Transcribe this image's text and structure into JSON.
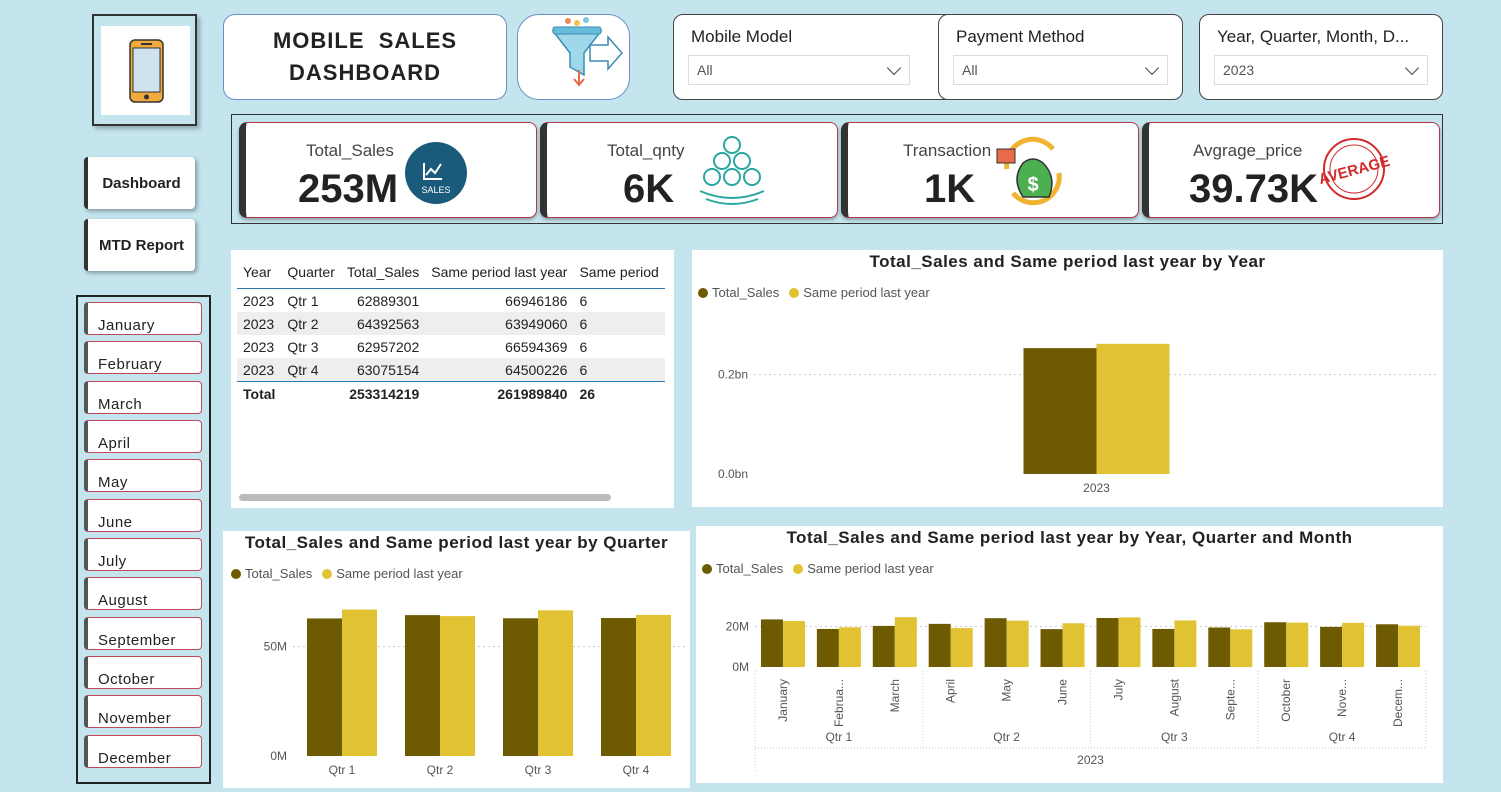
{
  "title": "MOBILE  SALES DASHBOARD",
  "title_line1": "MOBILE  SALES",
  "title_line2": "DASHBOARD",
  "nav": {
    "dashboard": "Dashboard",
    "mtd": "MTD Report"
  },
  "months": [
    "January",
    "February",
    "March",
    "April",
    "May",
    "June",
    "July",
    "August",
    "September",
    "October",
    "November",
    "December"
  ],
  "slicers": [
    {
      "label": "Mobile Model",
      "value": "All"
    },
    {
      "label": "Payment Method",
      "value": "All"
    },
    {
      "label": "Year, Quarter, Month, D...",
      "value": "2023"
    }
  ],
  "kpis": [
    {
      "label": "Total_Sales",
      "value": "253M",
      "icon": "sales-icon",
      "icon_text": "SALES"
    },
    {
      "label": "Total_qnty",
      "value": "6K",
      "icon": "stack-icon"
    },
    {
      "label": "Transaction",
      "value": "1K",
      "icon": "money-bag-icon"
    },
    {
      "label": "Avgrage_price",
      "value": "39.73K",
      "icon": "average-stamp-icon",
      "icon_text": "AVERAGE"
    }
  ],
  "table": {
    "headers": [
      "Year",
      "Quarter",
      "Total_Sales",
      "Same period last year",
      "Same period"
    ],
    "rows": [
      [
        "2023",
        "Qtr 1",
        "62889301",
        "66946186",
        "6"
      ],
      [
        "2023",
        "Qtr 2",
        "64392563",
        "63949060",
        "6"
      ],
      [
        "2023",
        "Qtr 3",
        "62957202",
        "66594369",
        "6"
      ],
      [
        "2023",
        "Qtr 4",
        "63075154",
        "64500226",
        "6"
      ]
    ],
    "total": [
      "Total",
      "",
      "253314219",
      "261989840",
      "26"
    ]
  },
  "colors": {
    "total_sales": "#6e5a00",
    "same_period": "#e1c232"
  },
  "legend": {
    "s1": "Total_Sales",
    "s2": "Same period last year"
  },
  "chart_data": [
    {
      "type": "bar",
      "title": "Total_Sales and Same period last year by Year",
      "categories": [
        "2023"
      ],
      "series": [
        {
          "name": "Total_Sales",
          "values": [
            253314219
          ]
        },
        {
          "name": "Same period last year",
          "values": [
            261989840
          ]
        }
      ],
      "yticks": [
        "0.0bn",
        "0.2bn"
      ],
      "ylim": [
        0,
        330000000
      ],
      "grid": true,
      "legend": "top-left"
    },
    {
      "type": "bar",
      "title": "Total_Sales and Same period last year by Quarter",
      "categories": [
        "Qtr 1",
        "Qtr 2",
        "Qtr 3",
        "Qtr 4"
      ],
      "series": [
        {
          "name": "Total_Sales",
          "values": [
            62889301,
            64392563,
            62957202,
            63075154
          ]
        },
        {
          "name": "Same period last year",
          "values": [
            66946186,
            63949060,
            66594369,
            64500226
          ]
        }
      ],
      "yticks": [
        "0M",
        "50M"
      ],
      "ylim": [
        0,
        80000000
      ],
      "grid": true,
      "legend": "top-left"
    },
    {
      "type": "bar",
      "title": "Total_Sales and Same period last year by Year, Quarter and Month",
      "categories": [
        "January",
        "Februa...",
        "March",
        "April",
        "May",
        "June",
        "July",
        "August",
        "Septe...",
        "October",
        "Nove...",
        "Decem..."
      ],
      "quarters": [
        "Qtr 1",
        "Qtr 2",
        "Qtr 3",
        "Qtr 4"
      ],
      "year": "2023",
      "series": [
        {
          "name": "Total_Sales",
          "values": [
            23500000,
            18800000,
            20300000,
            21300000,
            24100000,
            18700000,
            24200000,
            18800000,
            19500000,
            22100000,
            19800000,
            21100000
          ]
        },
        {
          "name": "Same period last year",
          "values": [
            22700000,
            19600000,
            24600000,
            19200000,
            22900000,
            21600000,
            24500000,
            23000000,
            18600000,
            21900000,
            21800000,
            20400000
          ]
        }
      ],
      "yticks": [
        "0M",
        "20M"
      ],
      "ylim": [
        0,
        40000000
      ],
      "grid": true,
      "legend": "top-left"
    }
  ]
}
